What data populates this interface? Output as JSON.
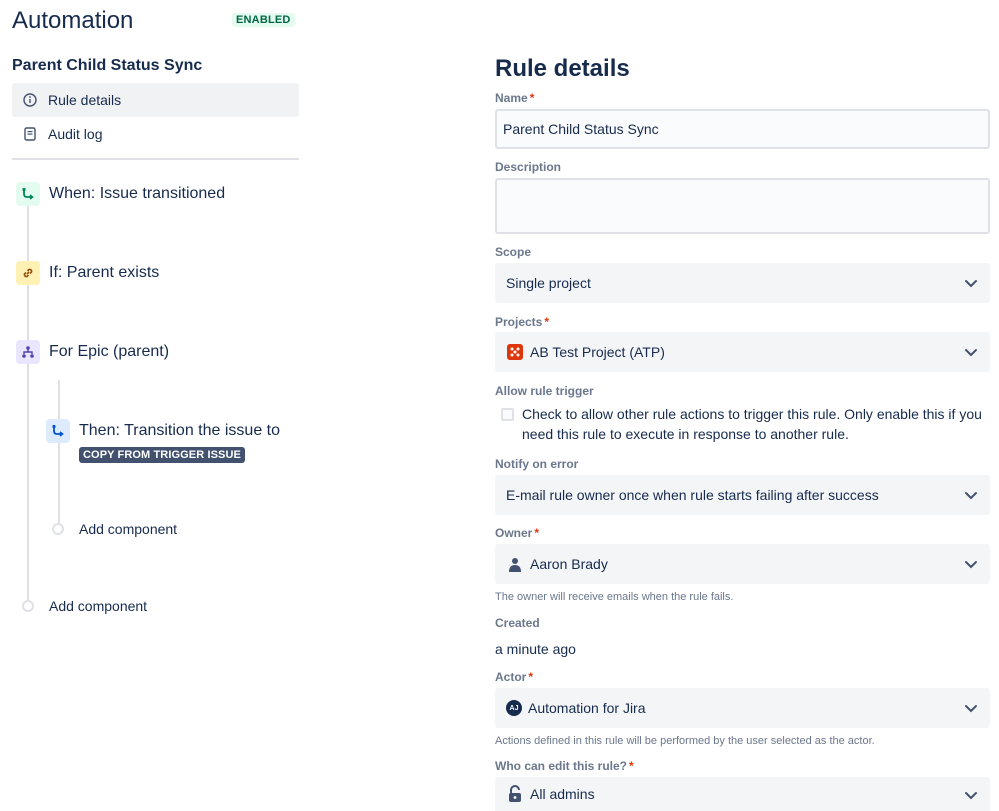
{
  "header": {
    "title": "Automation",
    "status": "ENABLED"
  },
  "sidebar": {
    "rule_name": "Parent Child Status Sync",
    "nav": [
      {
        "label": "Rule details",
        "icon": "info-icon",
        "active": true
      },
      {
        "label": "Audit log",
        "icon": "document-icon",
        "active": false
      }
    ]
  },
  "tree": {
    "trigger": {
      "label": "When: Issue transitioned",
      "icon": "trigger-icon"
    },
    "condition": {
      "label": "If: Parent exists",
      "icon": "link-icon"
    },
    "branch": {
      "label": "For Epic (parent)",
      "icon": "branch-icon"
    },
    "action": {
      "label": "Then: Transition the issue to",
      "icon": "action-icon",
      "value": "COPY FROM TRIGGER ISSUE"
    },
    "add_inner": "Add component",
    "add_outer": "Add component"
  },
  "details": {
    "title": "Rule details",
    "name": {
      "label": "Name",
      "required": "*",
      "value": "Parent Child Status Sync"
    },
    "description": {
      "label": "Description",
      "value": ""
    },
    "scope": {
      "label": "Scope",
      "value": "Single project"
    },
    "projects": {
      "label": "Projects",
      "required": "*",
      "value": "AB Test Project (ATP)"
    },
    "allow_trigger": {
      "label": "Allow rule trigger",
      "checkbox_text": "Check to allow other rule actions to trigger this rule. Only enable this if you need this rule to execute in response to another rule.",
      "checked": false
    },
    "notify": {
      "label": "Notify on error",
      "value": "E-mail rule owner once when rule starts failing after success"
    },
    "owner": {
      "label": "Owner",
      "required": "*",
      "value": "Aaron Brady",
      "helper": "The owner will receive emails when the rule fails."
    },
    "created": {
      "label": "Created",
      "value": "a minute ago"
    },
    "actor": {
      "label": "Actor",
      "required": "*",
      "value": "Automation for Jira",
      "avatar_initials": "AJ",
      "helper": "Actions defined in this rule will be performed by the user selected as the actor."
    },
    "editors": {
      "label": "Who can edit this rule?",
      "required": "*",
      "value": "All admins"
    }
  },
  "colors": {
    "trigger_bg": "#e3fcef",
    "trigger_fg": "#00875a",
    "condition_bg": "#fff0b3",
    "condition_fg": "#974f0c",
    "branch_bg": "#eae6ff",
    "branch_fg": "#5243aa",
    "action_bg": "#deebff",
    "action_fg": "#0052cc",
    "project_icon": "#de350b"
  }
}
